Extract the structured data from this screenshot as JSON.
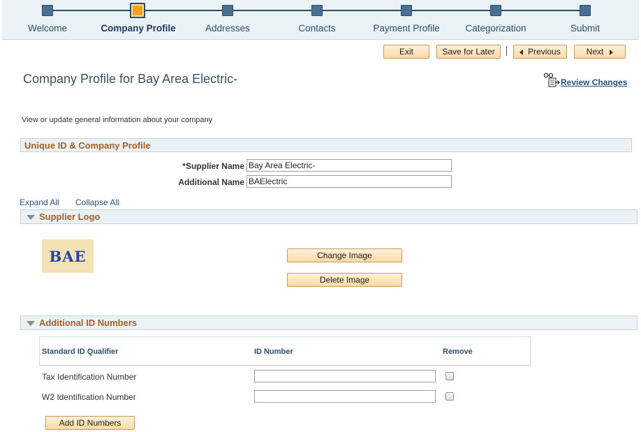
{
  "train": {
    "steps": [
      {
        "label": "Welcome",
        "state": "inactive"
      },
      {
        "label": "Company Profile",
        "state": "active"
      },
      {
        "label": "Addresses",
        "state": "inactive"
      },
      {
        "label": "Contacts",
        "state": "inactive"
      },
      {
        "label": "Payment Profile",
        "state": "inactive"
      },
      {
        "label": "Categorization",
        "state": "inactive"
      },
      {
        "label": "Submit",
        "state": "inactive"
      }
    ]
  },
  "toolbar": {
    "exit_label": "Exit",
    "save_later_label": "Save for Later",
    "separator": "|",
    "previous_label": "Previous",
    "next_label": "Next"
  },
  "page": {
    "title": "Company Profile for Bay Area Electric-",
    "review_changes_label": "Review Changes",
    "instructions": "View or update general information about your company"
  },
  "unique_id_section": {
    "title": "Unique ID & Company Profile",
    "supplier_name_label": "*Supplier Name",
    "supplier_name_value": "Bay Area Electric-",
    "additional_name_label": "Additional Name",
    "additional_name_value": "BAElectric"
  },
  "expand_all_label": "Expand All",
  "collapse_all_label": "Collapse All",
  "supplier_logo_section": {
    "title": "Supplier Logo",
    "logo_text": "BAE",
    "change_image_label": "Change Image",
    "delete_image_label": "Delete Image"
  },
  "additional_id_section": {
    "title": "Additional ID Numbers",
    "columns": [
      "Standard ID Qualifier",
      "ID Number",
      "Remove"
    ],
    "rows": [
      {
        "qualifier": "Tax Identification Number",
        "id_number": "",
        "remove": false
      },
      {
        "qualifier": "W2 Identification Number",
        "id_number": "",
        "remove": false
      }
    ],
    "add_button_label": "Add ID Numbers"
  },
  "colors": {
    "train_background": "#ebf2f6",
    "train_active": "#f6a21e",
    "train_inactive": "#4a6f93",
    "section_title": "#a55e24",
    "link": "#2a4f7b",
    "button_fill": "#fbd9a5"
  }
}
